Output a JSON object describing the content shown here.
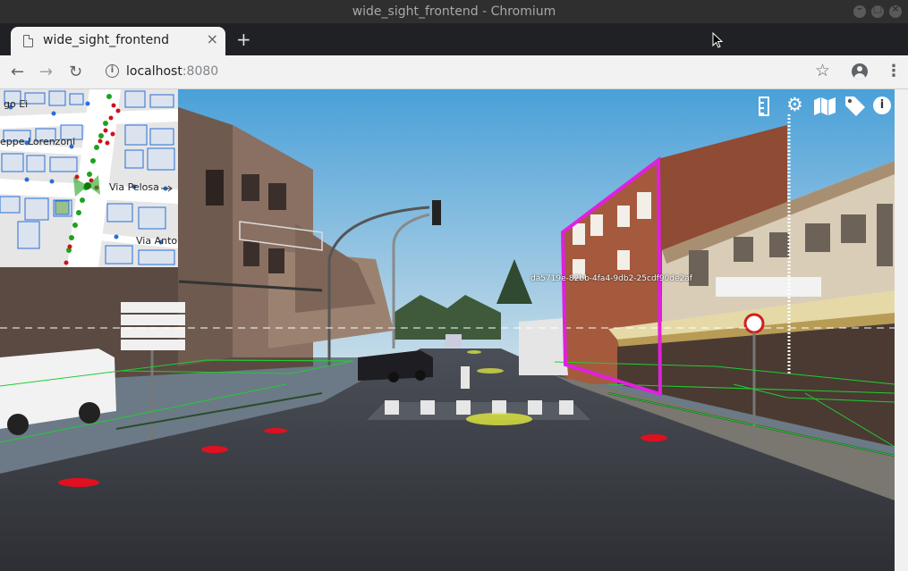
{
  "window": {
    "title": "wide_sight_frontend - Chromium"
  },
  "tabs": [
    {
      "title": "wide_sight_frontend",
      "close": "×"
    }
  ],
  "newtab_label": "+",
  "toolbar": {
    "back": "←",
    "forward": "→",
    "reload": "↻",
    "url_host": "localhost",
    "url_port": ":8080",
    "star": "☆",
    "menu": "⋮"
  },
  "app": {
    "icons": [
      "ruler-icon",
      "gear-icon",
      "map-icon",
      "tag-icon",
      "info-icon"
    ],
    "detection_label": "da5719e-82bb-4fa4-9db2-25cdf90de2af",
    "colors": {
      "detection_outline": "#e020e0",
      "ground_grid": "#22cc33",
      "marker_red": "#e01020",
      "marker_yellow": "#d8e040",
      "map_buildings": "#2a6fd6",
      "map_point_green": "#1fa21f",
      "map_point_red": "#d0101e"
    }
  },
  "minimap": {
    "streets": {
      "top_left": "go Ei",
      "mid_left": "eppe Lorenzoni",
      "east": "Via Pelosa",
      "bottom": "Via Anton"
    }
  }
}
